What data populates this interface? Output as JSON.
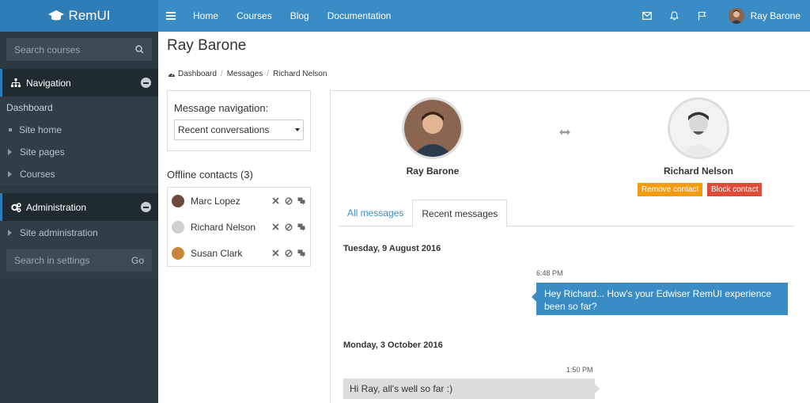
{
  "brand": {
    "name": "RemUI",
    "icon": "graduation-cap-icon"
  },
  "sidebar": {
    "search_placeholder": "Search courses",
    "navigation": {
      "title": "Navigation",
      "items": [
        {
          "label": "Dashboard",
          "level": 0
        },
        {
          "label": "Site home",
          "level": 1,
          "marker": "dot"
        },
        {
          "label": "Site pages",
          "level": 1,
          "marker": "caret"
        },
        {
          "label": "Courses",
          "level": 1,
          "marker": "caret"
        }
      ]
    },
    "administration": {
      "title": "Administration",
      "items": [
        {
          "label": "Site administration"
        }
      ],
      "search_placeholder": "Search in settings",
      "go_label": "Go"
    }
  },
  "topbar": {
    "nav": [
      "Home",
      "Courses",
      "Blog",
      "Documentation"
    ],
    "user_name": "Ray Barone",
    "icons": [
      "envelope-icon",
      "bell-icon",
      "flag-icon"
    ]
  },
  "page": {
    "title": "Ray Barone",
    "breadcrumb": [
      "Dashboard",
      "Messages",
      "Richard Nelson"
    ]
  },
  "message_nav": {
    "label": "Message navigation:",
    "selected": "Recent conversations"
  },
  "offline_contacts": {
    "title": "Offline contacts (3)",
    "contacts": [
      {
        "name": "Marc Lopez",
        "avatar_color": "#6b4a3a"
      },
      {
        "name": "Richard Nelson",
        "avatar_color": "#cfcfcf"
      },
      {
        "name": "Susan Clark",
        "avatar_color": "#c8843a"
      }
    ]
  },
  "conversation": {
    "user_a": "Ray Barone",
    "user_b": "Richard Nelson",
    "remove_label": "Remove contact",
    "block_label": "Block contact",
    "tabs": [
      "All messages",
      "Recent messages"
    ],
    "active_tab": "Recent messages",
    "messages": [
      {
        "date": "Tuesday, 9 August 2016",
        "time": "6:48 PM",
        "text": "Hey Richard... How's your Edwiser RemUI experience been so far?",
        "direction": "out"
      },
      {
        "date": "Monday, 3 October 2016",
        "time": "1:50 PM",
        "text": "Hi Ray, all's well so far :)",
        "direction": "in"
      }
    ]
  },
  "colors": {
    "primary": "#3a8cc4",
    "sidebar": "#2b3a42",
    "warning": "#f39c12",
    "danger": "#dd4b39"
  }
}
